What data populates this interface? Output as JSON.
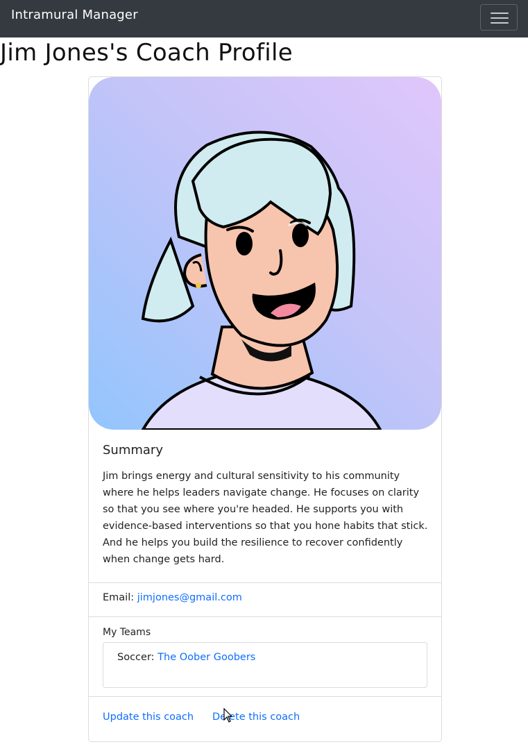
{
  "navbar": {
    "brand": "Intramural Manager",
    "toggle_icon": "hamburger-menu-icon",
    "background": "#343a40"
  },
  "page": {
    "title": "Jim Jones's Coach Profile"
  },
  "profile": {
    "summary_title": "Summary",
    "summary_text": "Jim brings energy and cultural sensitivity to his community where he helps leaders navigate change. He focuses on clarity so that you see where you're headed. He supports you with evidence-based interventions so that you hone habits that stick. And he helps you build the resilience to recover confidently when change gets hard.",
    "email_label": "Email:",
    "email_value": "jimjones@gmail.com",
    "teams_label": "My Teams",
    "teams": [
      {
        "sport": "Soccer:",
        "team": "The Oober Goobers"
      }
    ],
    "update_link": "Update this coach",
    "delete_link": "Delete this coach"
  },
  "colors": {
    "link": "#0d6efd",
    "text": "#212529"
  }
}
